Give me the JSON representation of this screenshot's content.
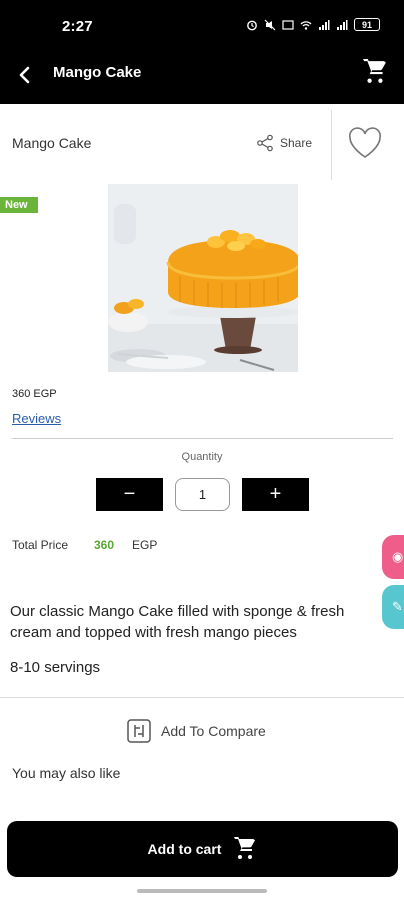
{
  "status": {
    "time": "2:27",
    "battery": "91"
  },
  "topbar": {
    "title": "Mango Cake"
  },
  "product": {
    "name": "Mango Cake",
    "share_label": "Share",
    "badge": "New",
    "price": "360 EGP",
    "reviews_label": "Reviews",
    "quantity_label": "Quantity",
    "quantity_value": "1",
    "minus_label": "−",
    "plus_label": "+",
    "total_label": "Total Price",
    "total_value": "360",
    "currency": "EGP",
    "description": "Our classic Mango Cake filled with sponge & fresh cream and topped with fresh mango pieces",
    "servings": "8-10 servings",
    "compare_label": "Add To Compare",
    "also_like": "You may also like",
    "add_to_cart": "Add to cart"
  },
  "colors": {
    "accent_green": "#5aa832",
    "badge_green": "#6bb43a",
    "link_blue": "#2a5eab",
    "side_pink": "#ef5d8a",
    "side_teal": "#57c6cf"
  },
  "icons": [
    "back-arrow-icon",
    "cart-icon",
    "share-icon",
    "heart-icon",
    "compare-icon",
    "cart-add-icon"
  ]
}
